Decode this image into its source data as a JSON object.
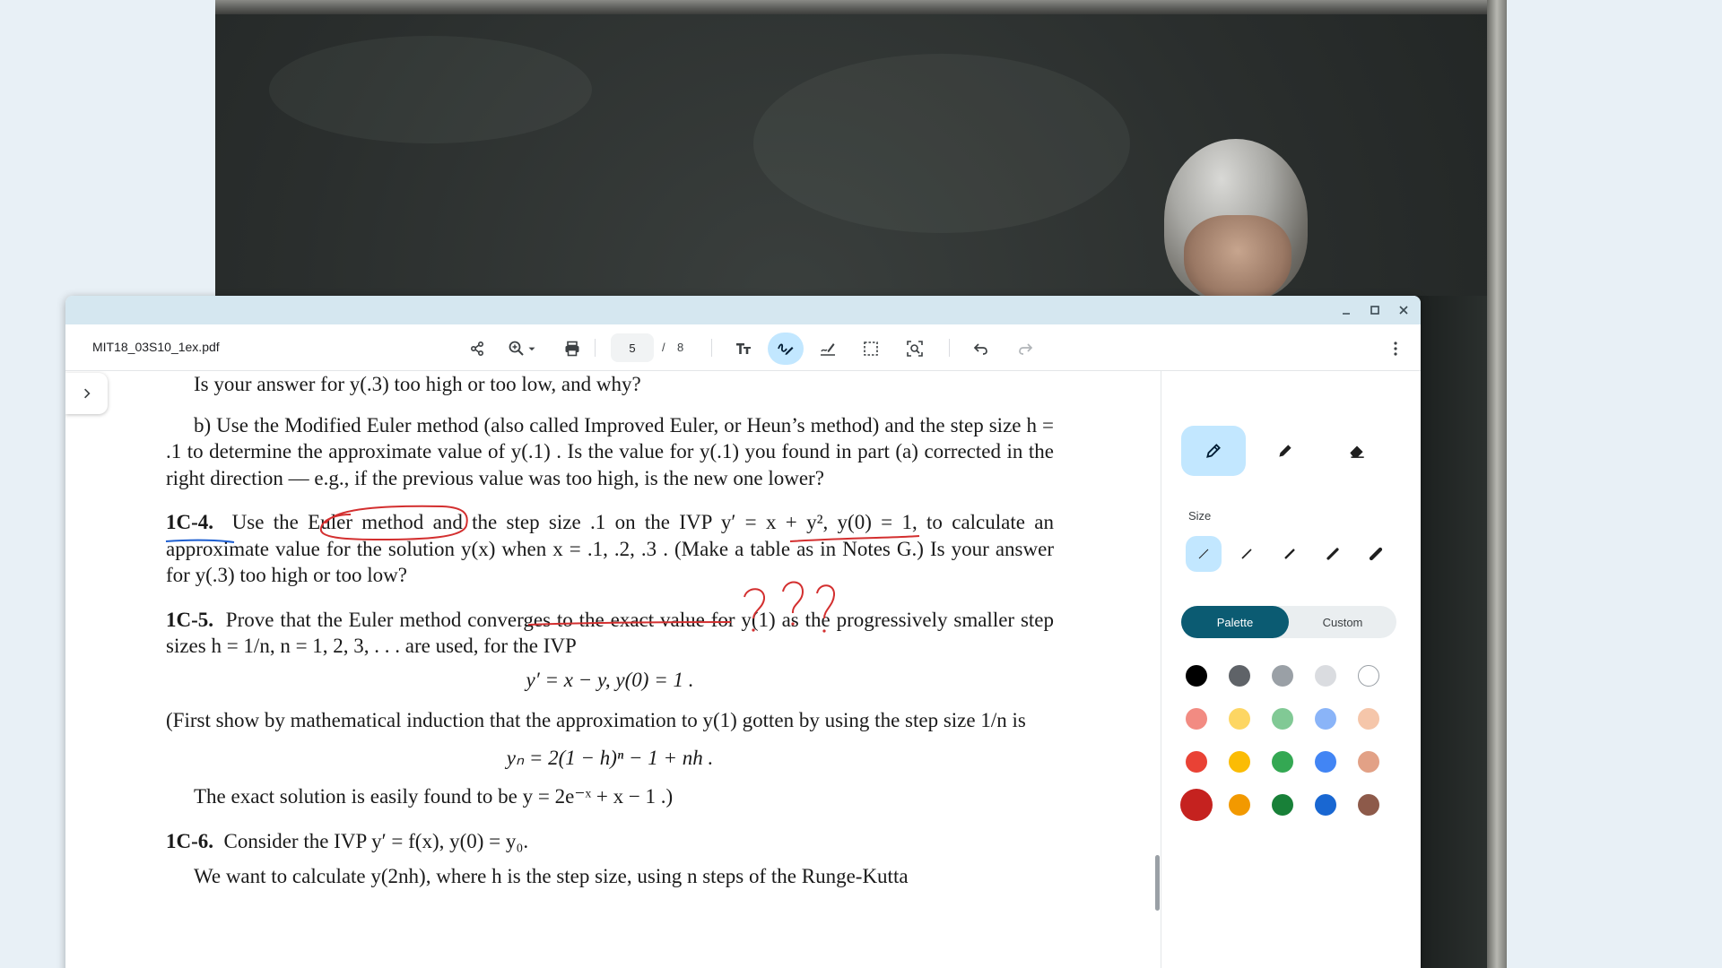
{
  "viewer": {
    "file_name": "MIT18_03S10_1ex.pdf",
    "current_page": "5",
    "page_separator": "/",
    "total_pages": "8",
    "window_controls": [
      "minimize-icon",
      "maximize-icon",
      "close-icon"
    ],
    "toolbar_icons": [
      "share-icon",
      "zoom-icon",
      "chevron-down-icon",
      "print-icon",
      "text-icon",
      "annotate-icon",
      "signature-icon",
      "select-area-icon",
      "screenshot-search-icon",
      "undo-icon",
      "redo-icon",
      "more-icon"
    ]
  },
  "document": {
    "line1": "Is your answer for y(.3) too high or too low, and why?",
    "para_b": "b) Use the Modified Euler method (also called Improved Euler, or Heun’s method) and the step size h = .1 to determine the approximate value of y(.1) . Is the value for y(.1) you found in part (a) corrected in the right direction — e.g., if the previous value was too high, is the new one lower?",
    "p1c4_label": "1C-4.",
    "p1c4_text": "Use the Euler method and the step size  .1  on the IVP  y′ = x + y²,   y(0) = 1,  to calculate an approximate value for the solution y(x) when x = .1, .2, .3 . (Make a table as in Notes G.) Is your answer for y(.3) too high or too low?",
    "p1c5_label": "1C-5.",
    "p1c5_text": "Prove that the Euler method converges to the exact value for y(1) as the progressively smaller step sizes  h = 1/n,    n = 1, 2, 3, . . .   are used, for the IVP",
    "eq1": "y′ = x − y,        y(0) = 1 .",
    "p1c5_first": "(First show by mathematical induction that the approximation to y(1) gotten by using the step size 1/n is",
    "eq2": "yₙ = 2(1 − h)ⁿ − 1 + nh .",
    "p1c5_exact": "The exact solution is easily found to be  y = 2e⁻ˣ + x − 1 .)",
    "p1c6_label": "1C-6.",
    "p1c6_text": "Consider the IVP  y′ = f(x),    y(0) = y₀.",
    "p1c6_cont": "We want to calculate  y(2nh),  where h is the step size, using n steps of the Runge-Kutta"
  },
  "annotation_panel": {
    "tools": [
      "pen-icon",
      "highlighter-icon",
      "eraser-icon"
    ],
    "selected_tool": "pen-icon",
    "size_label": "Size",
    "sizes": [
      "1",
      "2",
      "3",
      "4",
      "5"
    ],
    "selected_size": "1",
    "palette_label": "Palette",
    "custom_label": "Custom",
    "selected_mode": "Palette",
    "colors": [
      [
        "#000000",
        "#5f6368",
        "#9aa0a6",
        "#dadce0",
        "#ffffff"
      ],
      [
        "#f28b82",
        "#fdd663",
        "#81c995",
        "#8ab4f8",
        "#f5c6aa"
      ],
      [
        "#e94235",
        "#fbbc04",
        "#34a853",
        "#4285f4",
        "#e2a186"
      ],
      [
        "#c5221f",
        "#f29900",
        "#188038",
        "#1967d2",
        "#8d5a4a"
      ]
    ],
    "selected_color": "#c5221f"
  }
}
